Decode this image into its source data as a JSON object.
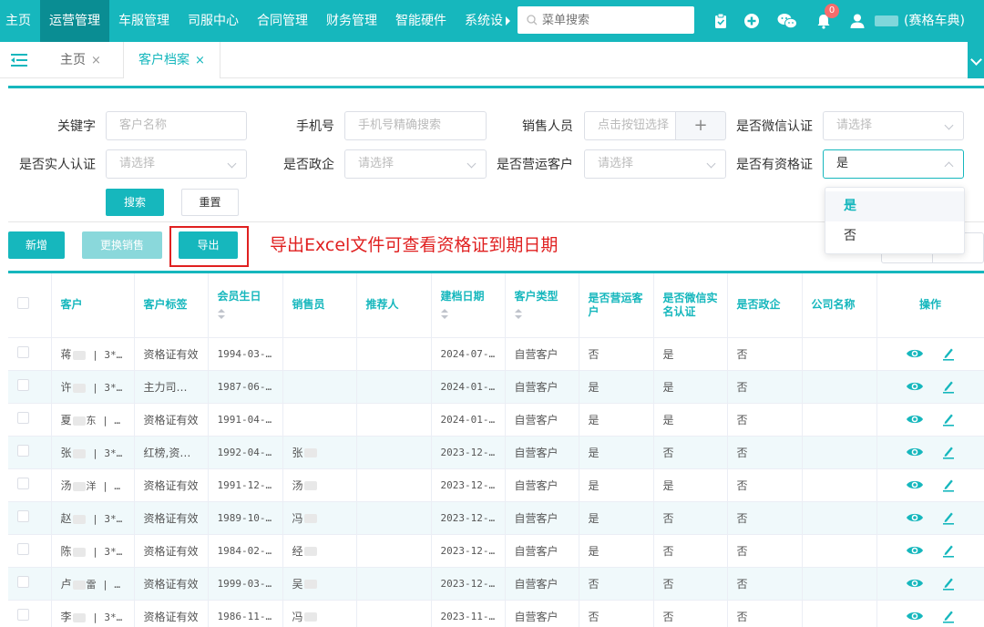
{
  "nav": {
    "items": [
      "主页",
      "运营管理",
      "车服管理",
      "司服中心",
      "合同管理",
      "财务管理",
      "智能硬件",
      "系统设"
    ],
    "active_index": 1,
    "search_placeholder": "菜单搜索",
    "badge_count": "0",
    "user_company": "(赛格车典)",
    "accent": "#16b7bd"
  },
  "tabs": {
    "items": [
      {
        "label": "主页",
        "close": "×"
      },
      {
        "label": "客户档案",
        "close": "×"
      }
    ],
    "active_index": 1
  },
  "filters": {
    "keyword_label": "关键字",
    "keyword_placeholder": "客户名称",
    "phone_label": "手机号",
    "phone_placeholder": "手机号精确搜索",
    "sales_label": "销售人员",
    "sales_placeholder": "点击按钮选择",
    "sales_add": "+",
    "wechat_label": "是否微信认证",
    "wechat_placeholder": "请选择",
    "realname_label": "是否实人认证",
    "realname_placeholder": "请选择",
    "gov_label": "是否政企",
    "gov_placeholder": "请选择",
    "operate_label": "是否营运客户",
    "operate_placeholder": "请选择",
    "cert_label": "是否有资格证",
    "cert_value": "是",
    "search_btn": "搜索",
    "reset_btn": "重置"
  },
  "dropdown": {
    "options": [
      "是",
      "否"
    ],
    "selected_index": 0
  },
  "toolbar": {
    "add_btn": "新增",
    "change_sales_btn": "更换销售",
    "export_btn": "导出",
    "annotation": "导出Excel文件可查看资格证到期日期"
  },
  "table": {
    "headers": [
      "客户",
      "客户标签",
      "会员生日",
      "销售员",
      "推荐人",
      "建档日期",
      "客户类型",
      "是否营运客户",
      "是否微信实名认证",
      "是否政企",
      "公司名称",
      "操作"
    ],
    "rows": [
      {
        "customer_a": "蒋",
        "customer_b": " | 3****:",
        "tag": "资格证有效",
        "birthday": "1994-03-…",
        "sales": "",
        "referrer": "",
        "created": "2024-07-…",
        "type": "自营客户",
        "operate": "否",
        "wechat": "是",
        "gov": "否",
        "company": ""
      },
      {
        "customer_a": "许",
        "customer_b": " | 3****:",
        "tag": "主力司机,…",
        "birthday": "1987-06-…",
        "sales": "",
        "referrer": "",
        "created": "2024-01-…",
        "type": "自营客户",
        "operate": "是",
        "wechat": "是",
        "gov": "否",
        "company": ""
      },
      {
        "customer_a": "夏",
        "customer_b": "东 | 3***",
        "tag": "资格证有效",
        "birthday": "1991-04-…",
        "sales": "",
        "referrer": "",
        "created": "2024-01-…",
        "type": "自营客户",
        "operate": "是",
        "wechat": "是",
        "gov": "否",
        "company": ""
      },
      {
        "customer_a": "张",
        "customer_b": " | 3****:",
        "tag": "红榜,资格…",
        "birthday": "1992-04-…",
        "sales": "张",
        "referrer": "",
        "created": "2023-12-…",
        "type": "自营客户",
        "operate": "是",
        "wechat": "否",
        "gov": "否",
        "company": ""
      },
      {
        "customer_a": "汤",
        "customer_b": "洋 | 3***",
        "tag": "资格证有效",
        "birthday": "1991-12-…",
        "sales": "汤",
        "referrer": "",
        "created": "2023-12-…",
        "type": "自营客户",
        "operate": "是",
        "wechat": "是",
        "gov": "否",
        "company": ""
      },
      {
        "customer_a": "赵",
        "customer_b": " | 3****:",
        "tag": "资格证有效",
        "birthday": "1989-10-…",
        "sales": "冯",
        "referrer": "",
        "created": "2023-12-…",
        "type": "自营客户",
        "operate": "是",
        "wechat": "否",
        "gov": "否",
        "company": ""
      },
      {
        "customer_a": "陈",
        "customer_b": " | 3****(",
        "tag": "资格证有效",
        "birthday": "1984-02-…",
        "sales": "经",
        "referrer": "",
        "created": "2023-12-…",
        "type": "自营客户",
        "operate": "是",
        "wechat": "否",
        "gov": "否",
        "company": ""
      },
      {
        "customer_a": "卢",
        "customer_b": "雷 | 3***",
        "tag": "资格证有效",
        "birthday": "1999-03-…",
        "sales": "吴",
        "referrer": "",
        "created": "2023-12-…",
        "type": "自营客户",
        "operate": "否",
        "wechat": "否",
        "gov": "否",
        "company": ""
      },
      {
        "customer_a": "李",
        "customer_b": " | 3****:",
        "tag": "资格证有效",
        "birthday": "1986-11-…",
        "sales": "冯",
        "referrer": "",
        "created": "2023-11-…",
        "type": "自营客户",
        "operate": "否",
        "wechat": "否",
        "gov": "否",
        "company": ""
      }
    ]
  }
}
